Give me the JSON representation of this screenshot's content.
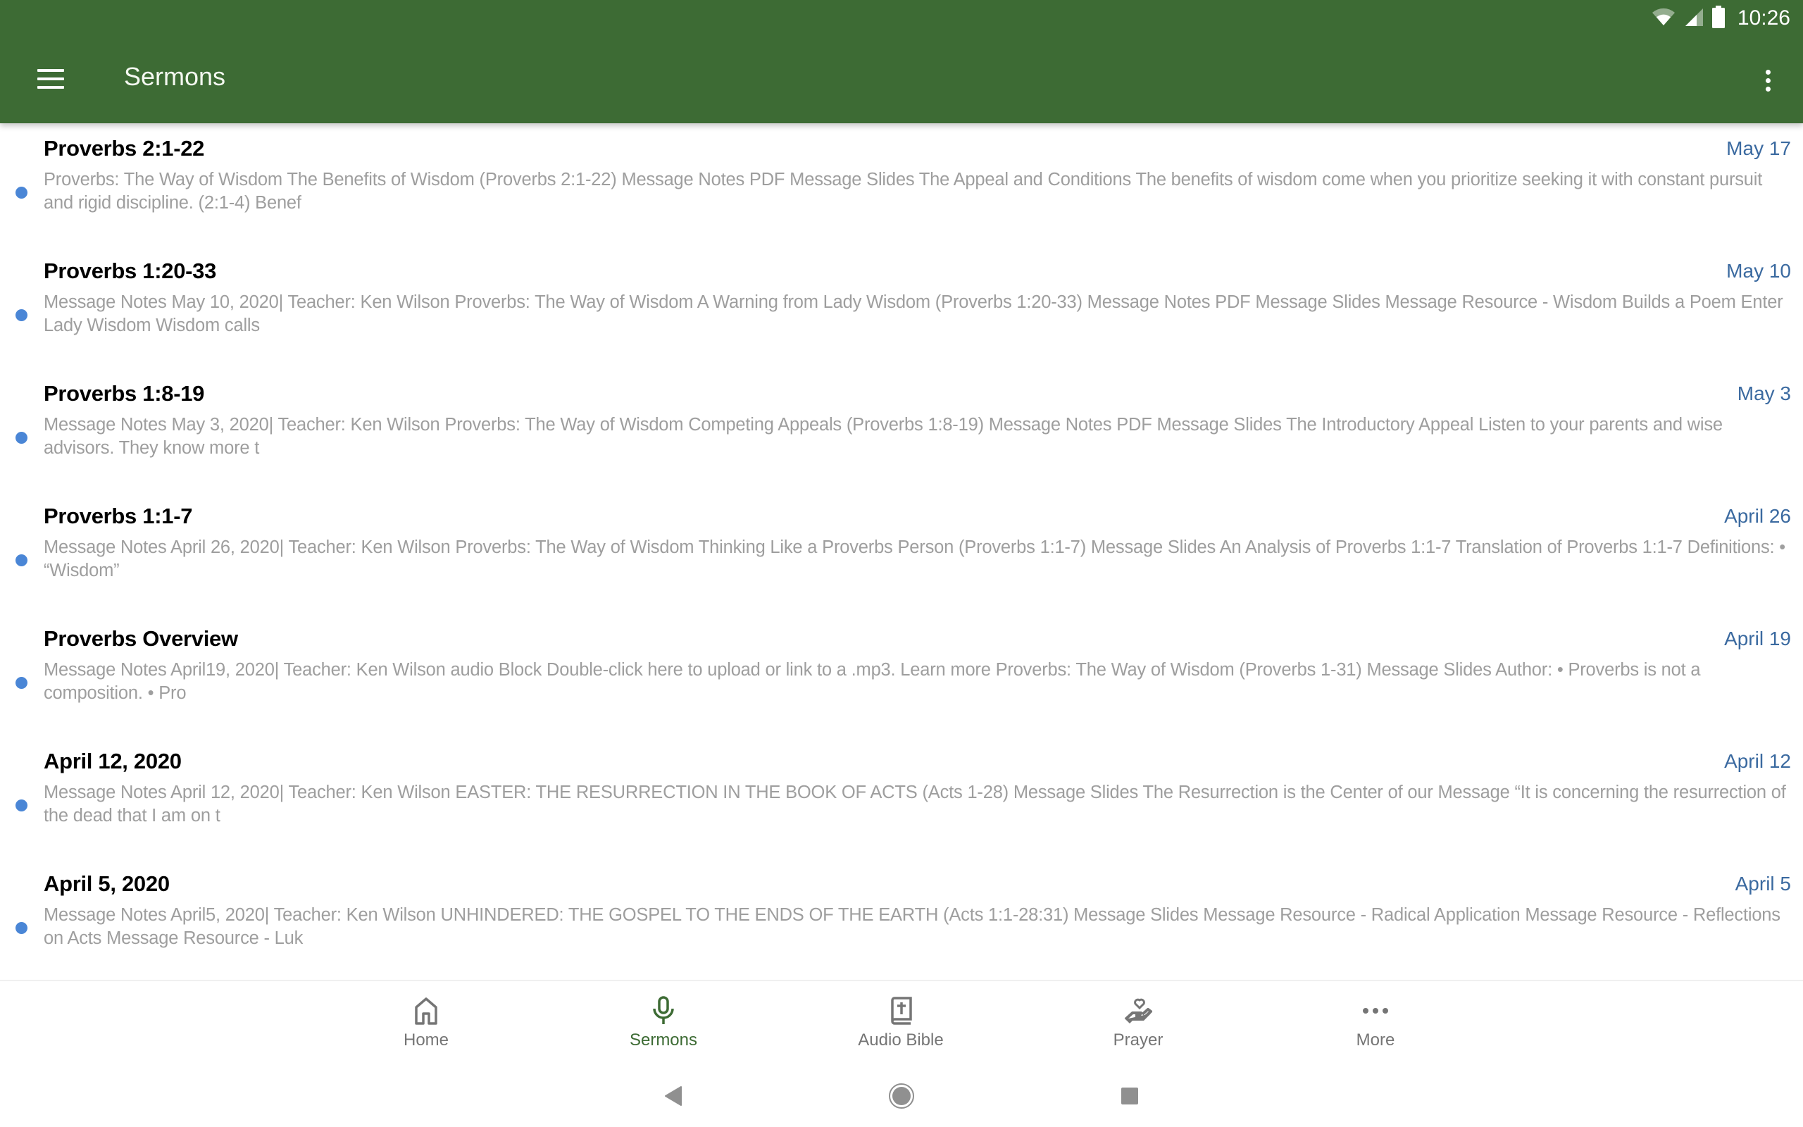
{
  "status_bar": {
    "time": "10:26",
    "icons": [
      "wifi-icon",
      "cell-signal-icon",
      "battery-icon"
    ]
  },
  "app_bar": {
    "title": "Sermons",
    "menu_icon": "hamburger-menu-icon",
    "overflow_icon": "more-vert-icon"
  },
  "colors": {
    "primary": "#3d6b34",
    "date_text": "#3b6aa0",
    "unread_dot": "#4a86d6",
    "description_text": "#9e9e9e",
    "inactive_nav": "#757575"
  },
  "sermons": [
    {
      "title": "Proverbs 2:1-22",
      "date": "May 17",
      "unread": true,
      "description": "Proverbs: The Way of Wisdom The Benefits of Wisdom (Proverbs 2:1-22) Message Notes PDF Message Slides The Appeal and Conditions The benefits of wisdom come when you prioritize seeking it with constant pursuit and rigid discipline. (2:1-4) Benef"
    },
    {
      "title": "Proverbs 1:20-33",
      "date": "May 10",
      "unread": true,
      "description": "Message Notes May 10, 2020| Teacher: Ken Wilson Proverbs: The Way of Wisdom A Warning from Lady Wisdom (Proverbs 1:20-33) Message Notes PDF Message Slides Message Resource - Wisdom Builds a Poem Enter Lady Wisdom Wisdom calls"
    },
    {
      "title": "Proverbs 1:8-19",
      "date": "May 3",
      "unread": true,
      "description": "Message Notes May 3, 2020| Teacher: Ken Wilson Proverbs: The Way of Wisdom Competing Appeals (Proverbs 1:8-19) Message Notes PDF Message Slides The Introductory Appeal Listen to your parents and wise advisors. They know more t"
    },
    {
      "title": "Proverbs 1:1-7",
      "date": "April 26",
      "unread": true,
      "description": "Message Notes April 26, 2020| Teacher: Ken Wilson Proverbs: The Way of Wisdom Thinking Like a Proverbs Person (Proverbs 1:1-7) Message Slides An Analysis of Proverbs 1:1-7 Translation of Proverbs 1:1-7 Definitions: • “Wisdom”"
    },
    {
      "title": "Proverbs Overview",
      "date": "April 19",
      "unread": true,
      "description": "Message Notes April19, 2020| Teacher: Ken Wilson audio Block Double-click here to upload or link to a .mp3. Learn more Proverbs: The Way of Wisdom (Proverbs 1-31) Message Slides Author: • Proverbs is not a composition. • Pro"
    },
    {
      "title": "April 12, 2020",
      "date": "April 12",
      "unread": true,
      "description": "Message Notes April 12, 2020| Teacher: Ken Wilson EASTER: THE RESURRECTION IN THE BOOK OF ACTS (Acts 1-28) Message Slides The Resurrection is the Center of our Message “It is concerning the resurrection of the dead that I am on t"
    },
    {
      "title": "April 5, 2020",
      "date": "April 5",
      "unread": true,
      "description": "Message Notes April5, 2020| Teacher: Ken Wilson UNHINDERED: THE GOSPEL TO THE ENDS OF THE EARTH (Acts 1:1-28:31) Message Slides Message Resource - Radical Application Message Resource - Reflections on Acts Message Resource - Luk"
    }
  ],
  "bottom_nav": {
    "active": "Sermons",
    "items": [
      {
        "label": "Home",
        "icon": "home-icon"
      },
      {
        "label": "Sermons",
        "icon": "microphone-icon"
      },
      {
        "label": "Audio Bible",
        "icon": "bible-icon"
      },
      {
        "label": "Prayer",
        "icon": "prayer-hand-heart-icon"
      },
      {
        "label": "More",
        "icon": "more-horiz-icon"
      }
    ]
  },
  "system_nav": {
    "buttons": [
      "back-icon",
      "home-circle-icon",
      "recents-icon"
    ]
  }
}
